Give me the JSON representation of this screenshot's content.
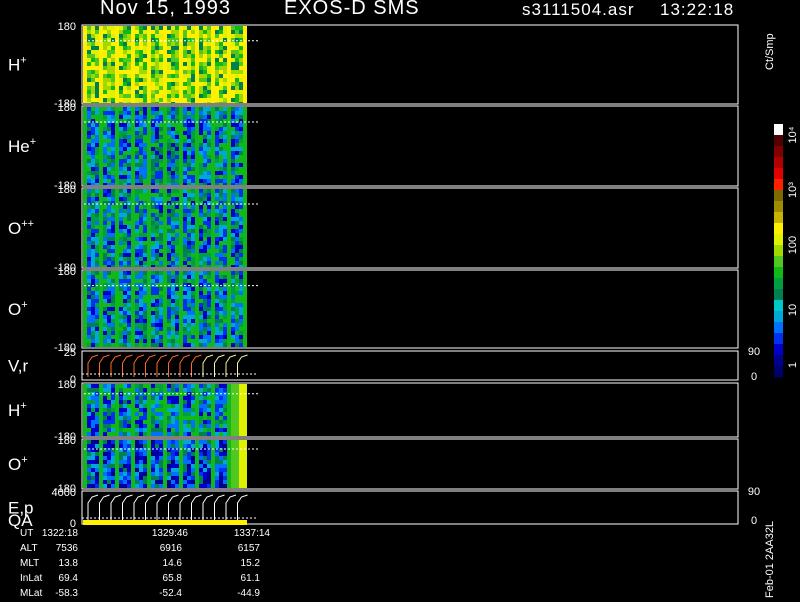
{
  "header": {
    "date": "Nov 15, 1993",
    "instrument": "EXOS-D SMS",
    "filename": "s3111504.asr",
    "time": "13:22:18"
  },
  "colorbar": {
    "unit_label": "Ct/Smp",
    "tick_labels": [
      "1",
      "10",
      "100",
      "10³",
      "10⁴"
    ],
    "colors": [
      "#00006a",
      "#000090",
      "#0000c8",
      "#0030f0",
      "#0070ff",
      "#00a8d8",
      "#00c8c8",
      "#008050",
      "#00a040",
      "#10b818",
      "#50c820",
      "#a0d800",
      "#e0f000",
      "#fff000",
      "#c8b400",
      "#a08c00",
      "#806800",
      "#ff2000",
      "#e00000",
      "#b00000",
      "#800000",
      "#500000",
      "#ffffff"
    ]
  },
  "footer": {
    "row_labels": [
      "UT",
      "ALT",
      "MLT",
      "InLat",
      "MLat"
    ],
    "columns": [
      [
        "1322:18",
        "7536",
        "13.8",
        "69.4",
        "-58.3"
      ],
      [
        "1329:46",
        "6916",
        "14.6",
        "65.8",
        "-52.4"
      ],
      [
        "1337:14",
        "6157",
        "15.2",
        "61.1",
        "-44.9"
      ]
    ],
    "orbit_label": "Feb-01 2AA32L"
  },
  "chart_data": {
    "type": "heatmap",
    "panels": [
      {
        "label": "H",
        "sup": "+",
        "y_ticks": [
          "180",
          "-180"
        ],
        "ylim": [
          -180,
          180
        ],
        "right_ticks": []
      },
      {
        "label": "He",
        "sup": "+",
        "y_ticks": [
          "180",
          "-180"
        ],
        "ylim": [
          -180,
          180
        ],
        "right_ticks": []
      },
      {
        "label": "O",
        "sup": "++",
        "y_ticks": [
          "180",
          "-180"
        ],
        "ylim": [
          -180,
          180
        ],
        "right_ticks": []
      },
      {
        "label": "O",
        "sup": "+",
        "y_ticks": [
          "180",
          "-180"
        ],
        "ylim": [
          -180,
          180
        ],
        "right_ticks": []
      },
      {
        "label": "V,r",
        "sup": "",
        "y_ticks": [
          "25",
          "0"
        ],
        "ylim": [
          0,
          25
        ],
        "right_ticks": [
          "90",
          "0"
        ]
      },
      {
        "label": "H",
        "sup": "+",
        "y_ticks": [
          "180",
          "-180"
        ],
        "ylim": [
          -180,
          180
        ],
        "right_ticks": []
      },
      {
        "label": "O",
        "sup": "+",
        "y_ticks": [
          "180",
          "-180"
        ],
        "ylim": [
          -180,
          180
        ],
        "right_ticks": []
      },
      {
        "label": "E,p",
        "sub": "QA",
        "sup": "",
        "y_ticks": [
          "4000",
          "0"
        ],
        "ylim": [
          0,
          4000
        ],
        "right_ticks": [
          "90",
          "0"
        ]
      }
    ],
    "x_ticks": [
      "1322:18",
      "1329:46",
      "1337:14"
    ],
    "data_extent_fraction": 0.25
  }
}
